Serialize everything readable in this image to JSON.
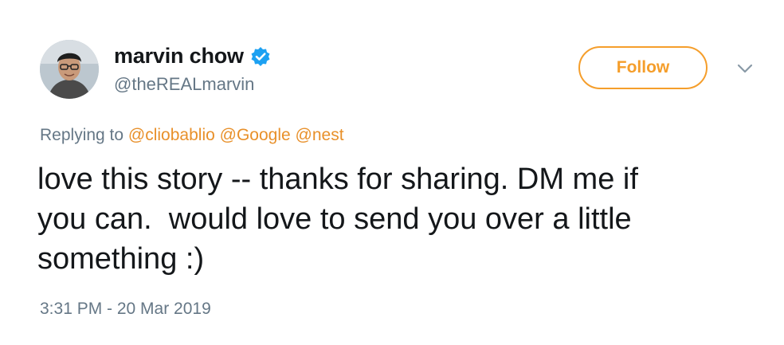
{
  "author": {
    "display_name": "marvin chow",
    "handle": "@theREALmarvin",
    "verified": true
  },
  "follow_button": {
    "label": "Follow"
  },
  "reply": {
    "prefix": "Replying to",
    "mentions": [
      "@cliobablio",
      "@Google",
      "@nest"
    ]
  },
  "tweet": {
    "line1": "love this story -- thanks for sharing. DM me if",
    "line2": "you can.  would love to send you over a little",
    "line3": "something :)",
    "timestamp": "3:31 PM - 20 Mar 2019"
  },
  "icons": {
    "verified": "verified-badge-icon",
    "caret": "chevron-down-icon"
  },
  "colors": {
    "accent": "#f59e2b",
    "mention": "#e8902a",
    "verified": "#1da1f2",
    "secondary_text": "#657786",
    "primary_text": "#14171a"
  }
}
